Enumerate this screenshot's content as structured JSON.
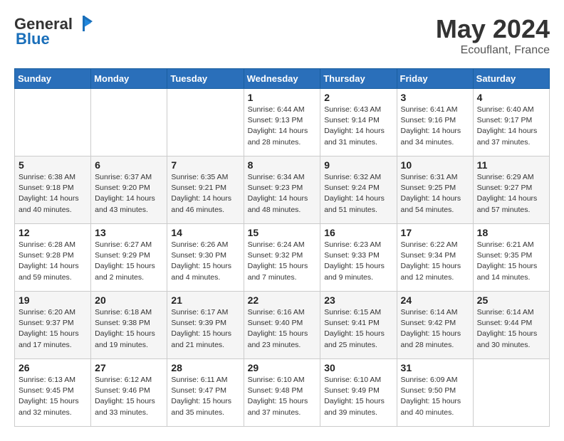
{
  "logo": {
    "general": "General",
    "blue": "Blue"
  },
  "title": "May 2024",
  "location": "Ecouflant, France",
  "days_header": [
    "Sunday",
    "Monday",
    "Tuesday",
    "Wednesday",
    "Thursday",
    "Friday",
    "Saturday"
  ],
  "weeks": [
    [
      {
        "day": "",
        "info": ""
      },
      {
        "day": "",
        "info": ""
      },
      {
        "day": "",
        "info": ""
      },
      {
        "day": "1",
        "info": "Sunrise: 6:44 AM\nSunset: 9:13 PM\nDaylight: 14 hours\nand 28 minutes."
      },
      {
        "day": "2",
        "info": "Sunrise: 6:43 AM\nSunset: 9:14 PM\nDaylight: 14 hours\nand 31 minutes."
      },
      {
        "day": "3",
        "info": "Sunrise: 6:41 AM\nSunset: 9:16 PM\nDaylight: 14 hours\nand 34 minutes."
      },
      {
        "day": "4",
        "info": "Sunrise: 6:40 AM\nSunset: 9:17 PM\nDaylight: 14 hours\nand 37 minutes."
      }
    ],
    [
      {
        "day": "5",
        "info": "Sunrise: 6:38 AM\nSunset: 9:18 PM\nDaylight: 14 hours\nand 40 minutes."
      },
      {
        "day": "6",
        "info": "Sunrise: 6:37 AM\nSunset: 9:20 PM\nDaylight: 14 hours\nand 43 minutes."
      },
      {
        "day": "7",
        "info": "Sunrise: 6:35 AM\nSunset: 9:21 PM\nDaylight: 14 hours\nand 46 minutes."
      },
      {
        "day": "8",
        "info": "Sunrise: 6:34 AM\nSunset: 9:23 PM\nDaylight: 14 hours\nand 48 minutes."
      },
      {
        "day": "9",
        "info": "Sunrise: 6:32 AM\nSunset: 9:24 PM\nDaylight: 14 hours\nand 51 minutes."
      },
      {
        "day": "10",
        "info": "Sunrise: 6:31 AM\nSunset: 9:25 PM\nDaylight: 14 hours\nand 54 minutes."
      },
      {
        "day": "11",
        "info": "Sunrise: 6:29 AM\nSunset: 9:27 PM\nDaylight: 14 hours\nand 57 minutes."
      }
    ],
    [
      {
        "day": "12",
        "info": "Sunrise: 6:28 AM\nSunset: 9:28 PM\nDaylight: 14 hours\nand 59 minutes."
      },
      {
        "day": "13",
        "info": "Sunrise: 6:27 AM\nSunset: 9:29 PM\nDaylight: 15 hours\nand 2 minutes."
      },
      {
        "day": "14",
        "info": "Sunrise: 6:26 AM\nSunset: 9:30 PM\nDaylight: 15 hours\nand 4 minutes."
      },
      {
        "day": "15",
        "info": "Sunrise: 6:24 AM\nSunset: 9:32 PM\nDaylight: 15 hours\nand 7 minutes."
      },
      {
        "day": "16",
        "info": "Sunrise: 6:23 AM\nSunset: 9:33 PM\nDaylight: 15 hours\nand 9 minutes."
      },
      {
        "day": "17",
        "info": "Sunrise: 6:22 AM\nSunset: 9:34 PM\nDaylight: 15 hours\nand 12 minutes."
      },
      {
        "day": "18",
        "info": "Sunrise: 6:21 AM\nSunset: 9:35 PM\nDaylight: 15 hours\nand 14 minutes."
      }
    ],
    [
      {
        "day": "19",
        "info": "Sunrise: 6:20 AM\nSunset: 9:37 PM\nDaylight: 15 hours\nand 17 minutes."
      },
      {
        "day": "20",
        "info": "Sunrise: 6:18 AM\nSunset: 9:38 PM\nDaylight: 15 hours\nand 19 minutes."
      },
      {
        "day": "21",
        "info": "Sunrise: 6:17 AM\nSunset: 9:39 PM\nDaylight: 15 hours\nand 21 minutes."
      },
      {
        "day": "22",
        "info": "Sunrise: 6:16 AM\nSunset: 9:40 PM\nDaylight: 15 hours\nand 23 minutes."
      },
      {
        "day": "23",
        "info": "Sunrise: 6:15 AM\nSunset: 9:41 PM\nDaylight: 15 hours\nand 25 minutes."
      },
      {
        "day": "24",
        "info": "Sunrise: 6:14 AM\nSunset: 9:42 PM\nDaylight: 15 hours\nand 28 minutes."
      },
      {
        "day": "25",
        "info": "Sunrise: 6:14 AM\nSunset: 9:44 PM\nDaylight: 15 hours\nand 30 minutes."
      }
    ],
    [
      {
        "day": "26",
        "info": "Sunrise: 6:13 AM\nSunset: 9:45 PM\nDaylight: 15 hours\nand 32 minutes."
      },
      {
        "day": "27",
        "info": "Sunrise: 6:12 AM\nSunset: 9:46 PM\nDaylight: 15 hours\nand 33 minutes."
      },
      {
        "day": "28",
        "info": "Sunrise: 6:11 AM\nSunset: 9:47 PM\nDaylight: 15 hours\nand 35 minutes."
      },
      {
        "day": "29",
        "info": "Sunrise: 6:10 AM\nSunset: 9:48 PM\nDaylight: 15 hours\nand 37 minutes."
      },
      {
        "day": "30",
        "info": "Sunrise: 6:10 AM\nSunset: 9:49 PM\nDaylight: 15 hours\nand 39 minutes."
      },
      {
        "day": "31",
        "info": "Sunrise: 6:09 AM\nSunset: 9:50 PM\nDaylight: 15 hours\nand 40 minutes."
      },
      {
        "day": "",
        "info": ""
      }
    ]
  ]
}
